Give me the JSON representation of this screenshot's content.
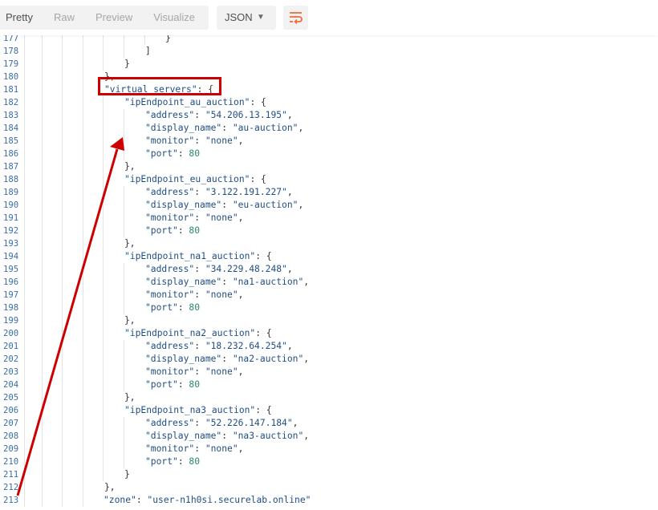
{
  "toolbar": {
    "tabs": [
      {
        "label": "Pretty",
        "active": true
      },
      {
        "label": "Raw",
        "active": false
      },
      {
        "label": "Preview",
        "active": false
      },
      {
        "label": "Visualize",
        "active": false
      }
    ],
    "format_select": {
      "value": "JSON"
    },
    "wrap_icon": "wrap-lines-icon"
  },
  "colors": {
    "keys": "#1f4e86",
    "numbers": "#2a8a66",
    "line_numbers": "#3a6ea5",
    "annotation": "#cc0000",
    "wrap_icon": "#f26b3a"
  },
  "code_lines": [
    {
      "n": "177",
      "i": 10,
      "t": [
        [
          "p",
          "}"
        ]
      ]
    },
    {
      "n": "178",
      "i": 9,
      "t": [
        [
          "p",
          "]"
        ]
      ]
    },
    {
      "n": "179",
      "i": 8,
      "t": [
        [
          "p",
          "}"
        ]
      ]
    },
    {
      "n": "180",
      "i": 7,
      "t": [
        [
          "p",
          "},"
        ]
      ]
    },
    {
      "n": "181",
      "i": 7,
      "t": [
        [
          "k",
          "\"virtual_servers\""
        ],
        [
          "p",
          ": {"
        ]
      ]
    },
    {
      "n": "182",
      "i": 8,
      "t": [
        [
          "k",
          "\"ipEndpoint_au_auction\""
        ],
        [
          "p",
          ": {"
        ]
      ]
    },
    {
      "n": "183",
      "i": 9,
      "t": [
        [
          "k",
          "\"address\""
        ],
        [
          "p",
          ": "
        ],
        [
          "s",
          "\"54.206.13.195\""
        ],
        [
          "p",
          ","
        ]
      ]
    },
    {
      "n": "184",
      "i": 9,
      "t": [
        [
          "k",
          "\"display_name\""
        ],
        [
          "p",
          ": "
        ],
        [
          "s",
          "\"au-auction\""
        ],
        [
          "p",
          ","
        ]
      ]
    },
    {
      "n": "185",
      "i": 9,
      "t": [
        [
          "k",
          "\"monitor\""
        ],
        [
          "p",
          ": "
        ],
        [
          "s",
          "\"none\""
        ],
        [
          "p",
          ","
        ]
      ]
    },
    {
      "n": "186",
      "i": 9,
      "t": [
        [
          "k",
          "\"port\""
        ],
        [
          "p",
          ": "
        ],
        [
          "n",
          "80"
        ]
      ]
    },
    {
      "n": "187",
      "i": 8,
      "t": [
        [
          "p",
          "},"
        ]
      ]
    },
    {
      "n": "188",
      "i": 8,
      "t": [
        [
          "k",
          "\"ipEndpoint_eu_auction\""
        ],
        [
          "p",
          ": {"
        ]
      ]
    },
    {
      "n": "189",
      "i": 9,
      "t": [
        [
          "k",
          "\"address\""
        ],
        [
          "p",
          ": "
        ],
        [
          "s",
          "\"3.122.191.227\""
        ],
        [
          "p",
          ","
        ]
      ]
    },
    {
      "n": "190",
      "i": 9,
      "t": [
        [
          "k",
          "\"display_name\""
        ],
        [
          "p",
          ": "
        ],
        [
          "s",
          "\"eu-auction\""
        ],
        [
          "p",
          ","
        ]
      ]
    },
    {
      "n": "191",
      "i": 9,
      "t": [
        [
          "k",
          "\"monitor\""
        ],
        [
          "p",
          ": "
        ],
        [
          "s",
          "\"none\""
        ],
        [
          "p",
          ","
        ]
      ]
    },
    {
      "n": "192",
      "i": 9,
      "t": [
        [
          "k",
          "\"port\""
        ],
        [
          "p",
          ": "
        ],
        [
          "n",
          "80"
        ]
      ]
    },
    {
      "n": "193",
      "i": 8,
      "t": [
        [
          "p",
          "},"
        ]
      ]
    },
    {
      "n": "194",
      "i": 8,
      "t": [
        [
          "k",
          "\"ipEndpoint_na1_auction\""
        ],
        [
          "p",
          ": {"
        ]
      ]
    },
    {
      "n": "195",
      "i": 9,
      "t": [
        [
          "k",
          "\"address\""
        ],
        [
          "p",
          ": "
        ],
        [
          "s",
          "\"34.229.48.248\""
        ],
        [
          "p",
          ","
        ]
      ]
    },
    {
      "n": "196",
      "i": 9,
      "t": [
        [
          "k",
          "\"display_name\""
        ],
        [
          "p",
          ": "
        ],
        [
          "s",
          "\"na1-auction\""
        ],
        [
          "p",
          ","
        ]
      ]
    },
    {
      "n": "197",
      "i": 9,
      "t": [
        [
          "k",
          "\"monitor\""
        ],
        [
          "p",
          ": "
        ],
        [
          "s",
          "\"none\""
        ],
        [
          "p",
          ","
        ]
      ]
    },
    {
      "n": "198",
      "i": 9,
      "t": [
        [
          "k",
          "\"port\""
        ],
        [
          "p",
          ": "
        ],
        [
          "n",
          "80"
        ]
      ]
    },
    {
      "n": "199",
      "i": 8,
      "t": [
        [
          "p",
          "},"
        ]
      ]
    },
    {
      "n": "200",
      "i": 8,
      "t": [
        [
          "k",
          "\"ipEndpoint_na2_auction\""
        ],
        [
          "p",
          ": {"
        ]
      ]
    },
    {
      "n": "201",
      "i": 9,
      "t": [
        [
          "k",
          "\"address\""
        ],
        [
          "p",
          ": "
        ],
        [
          "s",
          "\"18.232.64.254\""
        ],
        [
          "p",
          ","
        ]
      ]
    },
    {
      "n": "202",
      "i": 9,
      "t": [
        [
          "k",
          "\"display_name\""
        ],
        [
          "p",
          ": "
        ],
        [
          "s",
          "\"na2-auction\""
        ],
        [
          "p",
          ","
        ]
      ]
    },
    {
      "n": "203",
      "i": 9,
      "t": [
        [
          "k",
          "\"monitor\""
        ],
        [
          "p",
          ": "
        ],
        [
          "s",
          "\"none\""
        ],
        [
          "p",
          ","
        ]
      ]
    },
    {
      "n": "204",
      "i": 9,
      "t": [
        [
          "k",
          "\"port\""
        ],
        [
          "p",
          ": "
        ],
        [
          "n",
          "80"
        ]
      ]
    },
    {
      "n": "205",
      "i": 8,
      "t": [
        [
          "p",
          "},"
        ]
      ]
    },
    {
      "n": "206",
      "i": 8,
      "t": [
        [
          "k",
          "\"ipEndpoint_na3_auction\""
        ],
        [
          "p",
          ": {"
        ]
      ]
    },
    {
      "n": "207",
      "i": 9,
      "t": [
        [
          "k",
          "\"address\""
        ],
        [
          "p",
          ": "
        ],
        [
          "s",
          "\"52.226.147.184\""
        ],
        [
          "p",
          ","
        ]
      ]
    },
    {
      "n": "208",
      "i": 9,
      "t": [
        [
          "k",
          "\"display_name\""
        ],
        [
          "p",
          ": "
        ],
        [
          "s",
          "\"na3-auction\""
        ],
        [
          "p",
          ","
        ]
      ]
    },
    {
      "n": "209",
      "i": 9,
      "t": [
        [
          "k",
          "\"monitor\""
        ],
        [
          "p",
          ": "
        ],
        [
          "s",
          "\"none\""
        ],
        [
          "p",
          ","
        ]
      ]
    },
    {
      "n": "210",
      "i": 9,
      "t": [
        [
          "k",
          "\"port\""
        ],
        [
          "p",
          ": "
        ],
        [
          "n",
          "80"
        ]
      ]
    },
    {
      "n": "211",
      "i": 8,
      "t": [
        [
          "p",
          "}"
        ]
      ]
    },
    {
      "n": "212",
      "i": 7,
      "t": [
        [
          "p",
          "},"
        ]
      ]
    },
    {
      "n": "213",
      "i": 6,
      "t": [
        [
          "k",
          "\"zone\""
        ],
        [
          "p",
          ": "
        ],
        [
          "s",
          "\"user-n1h0si.securelab.online\""
        ]
      ]
    }
  ]
}
